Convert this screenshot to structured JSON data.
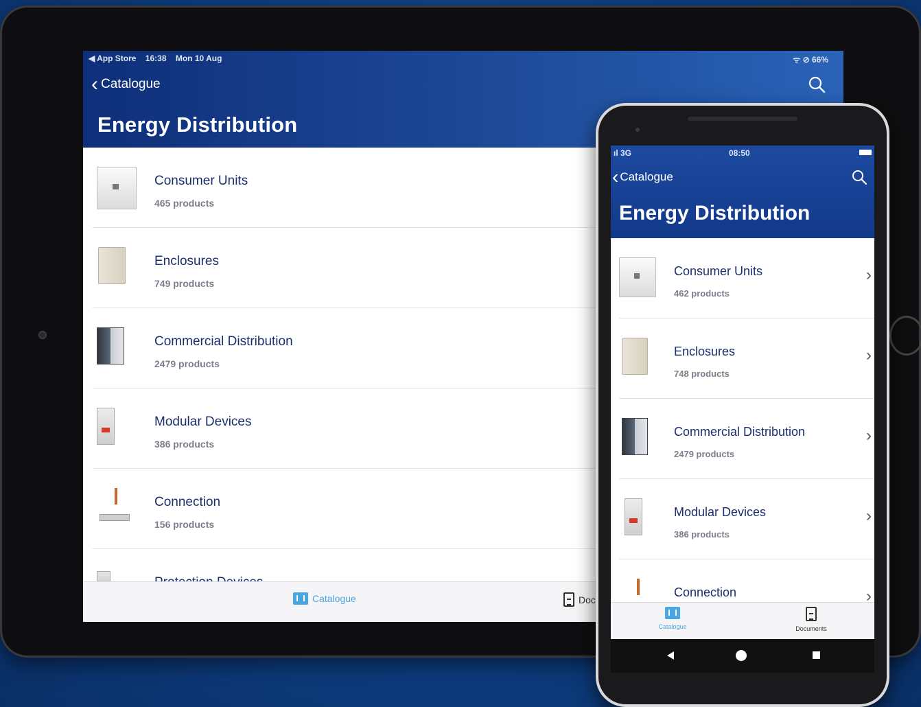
{
  "tablet": {
    "status": {
      "carrier": "◀ App Store",
      "time": "16:38",
      "date": "Mon 10 Aug",
      "right": "ᯤ ⊘ 66%"
    },
    "nav": {
      "back_label": "Catalogue"
    },
    "title": "Energy Distribution",
    "items": [
      {
        "name": "Consumer Units",
        "count": "465 products",
        "icon": "consumer-unit"
      },
      {
        "name": "Enclosures",
        "count": "749 products",
        "icon": "enclosure"
      },
      {
        "name": "Commercial Distribution",
        "count": "2479 products",
        "icon": "commercial-distribution"
      },
      {
        "name": "Modular Devices",
        "count": "386 products",
        "icon": "modular-device"
      },
      {
        "name": "Connection",
        "count": "156 products",
        "icon": "connection"
      },
      {
        "name": "Protection Devices",
        "count": "",
        "icon": "protection-device"
      }
    ],
    "tabs": {
      "catalogue": "Catalogue",
      "documents": "Doc"
    }
  },
  "phone": {
    "status": {
      "signal": "ıl 3G",
      "time": "08:50"
    },
    "nav": {
      "back_label": "Catalogue"
    },
    "title": "Energy Distribution",
    "items": [
      {
        "name": "Consumer Units",
        "count": "462 products",
        "icon": "consumer-unit"
      },
      {
        "name": "Enclosures",
        "count": "748 products",
        "icon": "enclosure"
      },
      {
        "name": "Commercial Distribution",
        "count": "2479 products",
        "icon": "commercial-distribution"
      },
      {
        "name": "Modular Devices",
        "count": "386 products",
        "icon": "modular-device"
      },
      {
        "name": "Connection",
        "count": "",
        "icon": "connection"
      }
    ],
    "tabs": {
      "catalogue": "Catalogue",
      "documents": "Documents"
    }
  },
  "colors": {
    "header_blue": "#12398a",
    "accent": "#4aa6e0",
    "item_text": "#1b2f6e"
  }
}
